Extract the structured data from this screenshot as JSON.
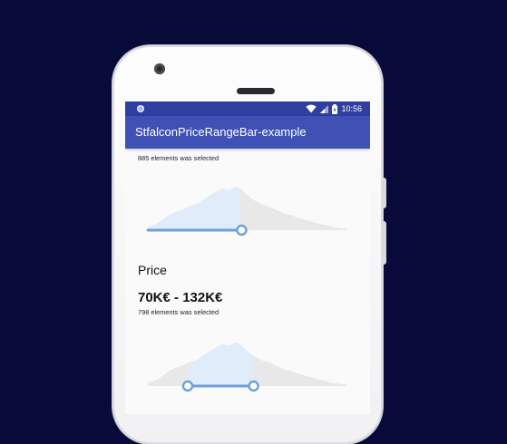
{
  "statusbar": {
    "time": "10:56",
    "icons": [
      "notification-dot-icon",
      "wifi-icon",
      "signal-icon",
      "battery-icon"
    ]
  },
  "appbar": {
    "title": "StfalconPriceRangeBar-example"
  },
  "first_bar": {
    "selected_text": "885 elements was selected",
    "thumb_fraction": 0.47
  },
  "second_bar": {
    "section_title": "Price",
    "range_text": "70K€ - 132K€",
    "selected_text": "798 elements was selected",
    "thumb_start_fraction": 0.2,
    "thumb_end_fraction": 0.53
  },
  "colors": {
    "background": "#080b3a",
    "statusbar": "#303f9f",
    "appbar": "#3f51b5",
    "bar_inactive": "#e8e8e8",
    "bar_active": "#e1ecfa",
    "track": "#6ea0d8"
  }
}
